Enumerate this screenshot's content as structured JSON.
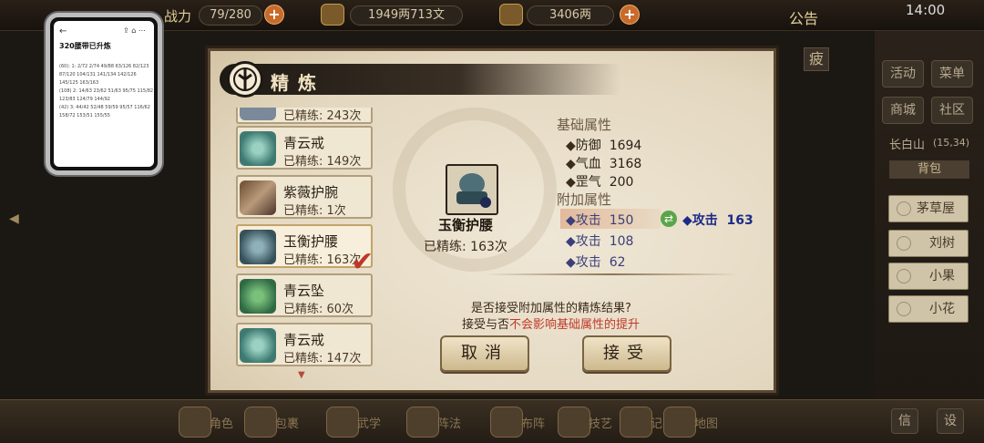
{
  "hud": {
    "combat_label": "战力",
    "stamina": "79/280",
    "money": "1949两713文",
    "ingots": "3406两",
    "notice": "公告",
    "clock": "14:00"
  },
  "fatigue": "疲",
  "phone_overlay": {
    "title": "320腰带已升炼",
    "subtitle": "",
    "lines": [
      "(60): 1: 2/72 2/74 49/88 63/126 82/123",
      "87/120 104/131 141/134 142/126 145/125 163/163",
      "(108) 2: 14/63 23/62 51/63 95/75 115/82",
      "123/83 124/79 144/92",
      "(42) 3: 44/42 52/48 59/59 95/57 116/62",
      "158/72 153/51 155/55"
    ]
  },
  "side_menu": {
    "buttons": [
      "活动",
      "菜单",
      "商城",
      "社区"
    ],
    "location": "长白山",
    "coords": "(15,34)",
    "bag_label": "背包",
    "npcs": [
      "茅草屋",
      "刘树",
      "小果",
      "小花"
    ]
  },
  "bottom_dock": [
    "角色",
    "包裹",
    "武学",
    "阵法",
    "布阵",
    "技艺",
    "记事",
    "地图"
  ],
  "bottom_right": [
    "信",
    "设"
  ],
  "dialog": {
    "title": "精炼",
    "items": [
      {
        "name": "",
        "refine": "已精练: 243次"
      },
      {
        "name": "青云戒",
        "refine": "已精练: 149次"
      },
      {
        "name": "紫薇护腕",
        "refine": "已精练: 1次"
      },
      {
        "name": "玉衡护腰",
        "refine": "已精练: 163次"
      },
      {
        "name": "青云坠",
        "refine": "已精练: 60次"
      },
      {
        "name": "青云戒",
        "refine": "已精练: 147次"
      }
    ],
    "selected_item": {
      "name": "玉衡护腰",
      "refine": "已精练: 163次"
    },
    "base_attr_title": "基础属性",
    "base_attrs": [
      {
        "label": "防御",
        "value": "1694"
      },
      {
        "label": "气血",
        "value": "3168"
      },
      {
        "label": "罡气",
        "value": "200"
      }
    ],
    "add_attr_title": "附加属性",
    "add_attrs": [
      {
        "label": "攻击",
        "value": "150"
      },
      {
        "label": "攻击",
        "value": "108"
      },
      {
        "label": "攻击",
        "value": "62"
      }
    ],
    "new_attr": {
      "label": "攻击",
      "value": "163"
    },
    "prompt_line1": "是否接受附加属性的精炼结果?",
    "prompt_line2_prefix": "接受与否",
    "prompt_line2_warn": "不会影响基础属性的提升",
    "cancel_label": "取消",
    "accept_label": "接受"
  },
  "colors": {
    "accent_red": "#c03a2a",
    "stat_blue": "#3a3f7a",
    "new_stat_blue": "#1d2a88",
    "parchment": "#e9e0cd"
  }
}
